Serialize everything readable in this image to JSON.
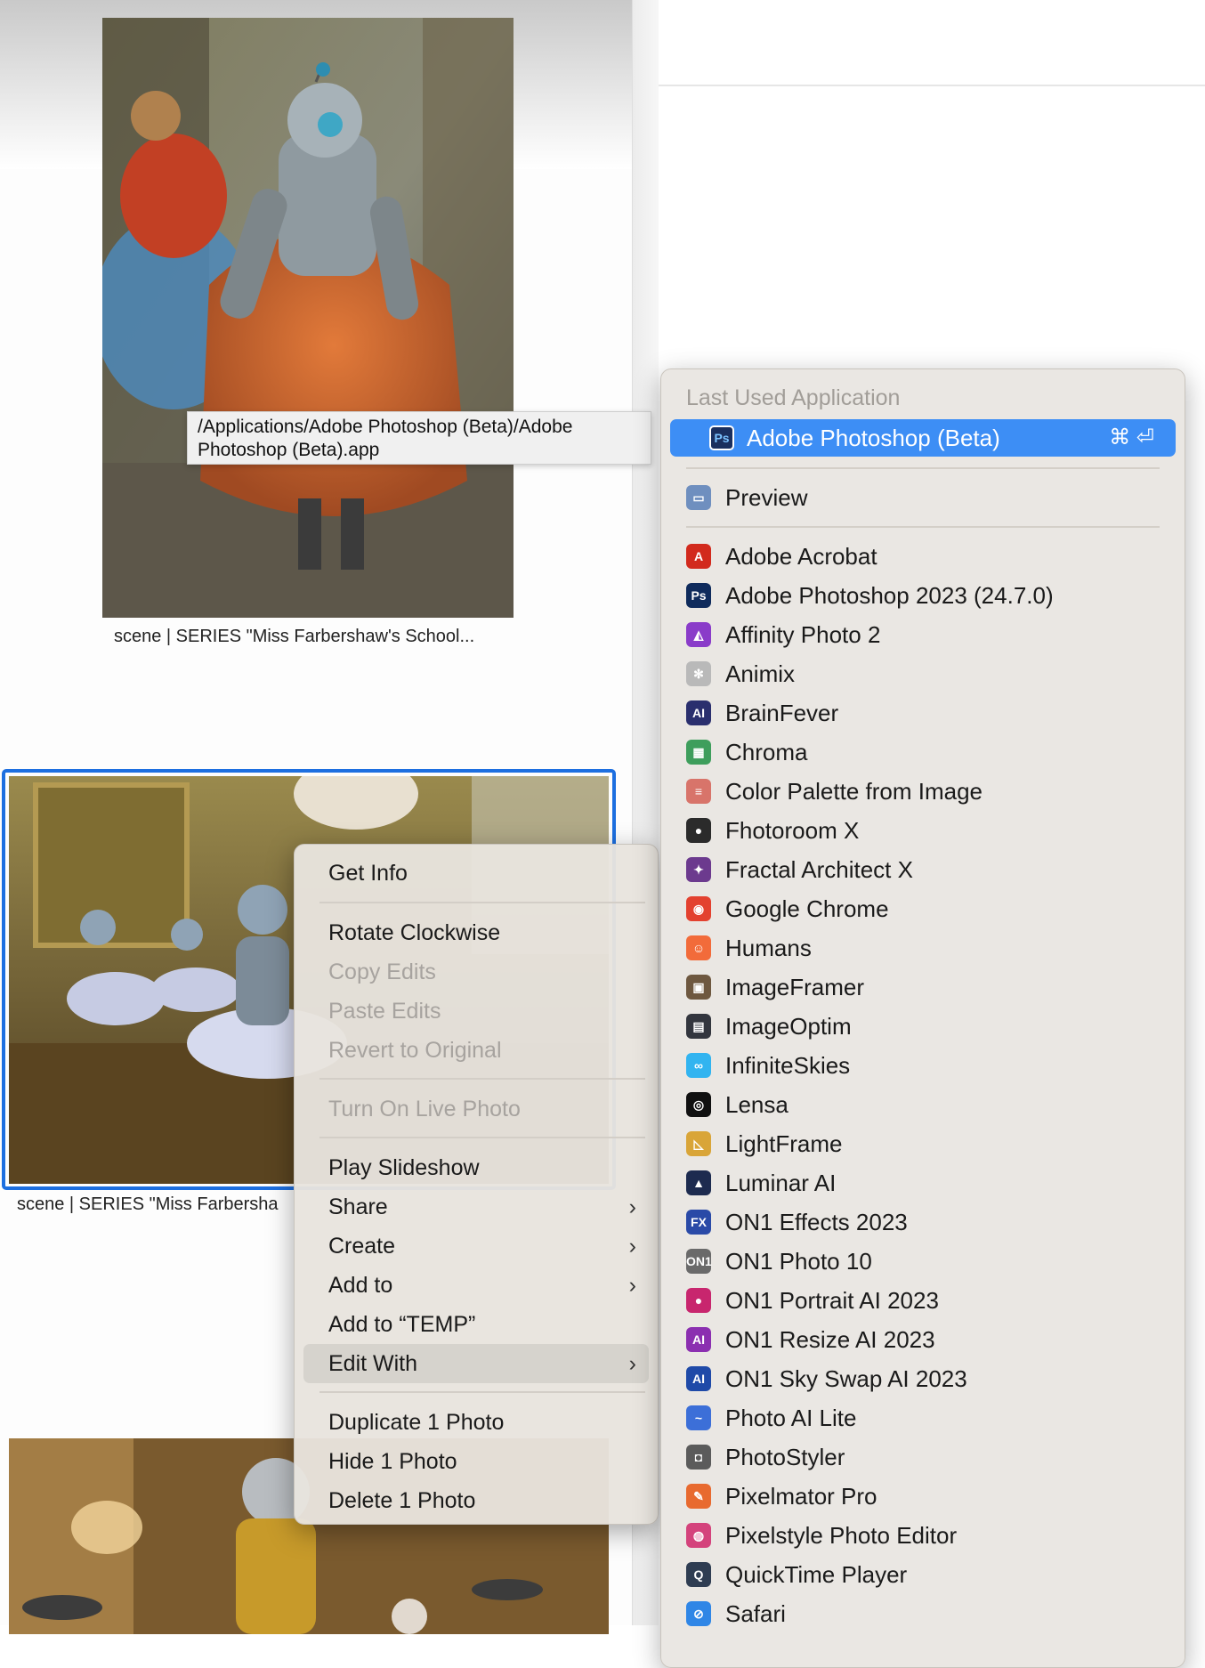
{
  "photos": [
    {
      "caption": "scene | SERIES \"Miss Farbershaw's School..."
    },
    {
      "caption": "scene | SERIES \"Miss Farbersha"
    }
  ],
  "tooltip": {
    "line1": "/Applications/Adobe Photoshop (Beta)/Adobe",
    "line2": "Photoshop (Beta).app"
  },
  "context_menu": {
    "get_info": "Get Info",
    "rotate_clockwise": "Rotate Clockwise",
    "copy_edits": "Copy Edits",
    "paste_edits": "Paste Edits",
    "revert_to_original": "Revert to Original",
    "turn_on_live_photo": "Turn On Live Photo",
    "play_slideshow": "Play Slideshow",
    "share": "Share",
    "create": "Create",
    "add_to": "Add to",
    "add_to_temp": "Add to “TEMP”",
    "edit_with": "Edit With",
    "duplicate": "Duplicate 1 Photo",
    "hide": "Hide 1 Photo",
    "delete": "Delete 1 Photo",
    "chevron": "›"
  },
  "submenu": {
    "header": "Last Used Application",
    "last_used": {
      "label": "Adobe Photoshop (Beta)",
      "icon_text": "Ps",
      "shortcut": "⌘ ⏎"
    },
    "preview": {
      "label": "Preview",
      "icon_color": "#6f8fbf"
    },
    "apps": [
      {
        "label": "Adobe Acrobat",
        "icon_color": "#d22a1d",
        "icon_text": "A"
      },
      {
        "label": "Adobe Photoshop 2023 (24.7.0)",
        "icon_color": "#0f2b5c",
        "icon_text": "Ps"
      },
      {
        "label": "Affinity Photo 2",
        "icon_color": "#8a3cc9",
        "icon_text": "◭"
      },
      {
        "label": "Animix",
        "icon_color": "#b9b9b9",
        "icon_text": "✻"
      },
      {
        "label": "BrainFever",
        "icon_color": "#2a2f6e",
        "icon_text": "AI"
      },
      {
        "label": "Chroma",
        "icon_color": "#3e9e5c",
        "icon_text": "▦"
      },
      {
        "label": "Color Palette from Image",
        "icon_color": "#d8746a",
        "icon_text": "≡"
      },
      {
        "label": "Fhotoroom X",
        "icon_color": "#2b2b2b",
        "icon_text": "●"
      },
      {
        "label": "Fractal Architect X",
        "icon_color": "#6c3a8e",
        "icon_text": "✦"
      },
      {
        "label": "Google Chrome",
        "icon_color": "#e3412f",
        "icon_text": "◉"
      },
      {
        "label": "Humans",
        "icon_color": "#f26b3a",
        "icon_text": "☺"
      },
      {
        "label": "ImageFramer",
        "icon_color": "#6e5840",
        "icon_text": "▣"
      },
      {
        "label": "ImageOptim",
        "icon_color": "#33363e",
        "icon_text": "▤"
      },
      {
        "label": "InfiniteSkies",
        "icon_color": "#32b4f0",
        "icon_text": "∞"
      },
      {
        "label": "Lensa",
        "icon_color": "#111111",
        "icon_text": "◎"
      },
      {
        "label": "LightFrame",
        "icon_color": "#d9a538",
        "icon_text": "◺"
      },
      {
        "label": "Luminar AI",
        "icon_color": "#1d2b4f",
        "icon_text": "▲"
      },
      {
        "label": "ON1 Effects 2023",
        "icon_color": "#2a4aa7",
        "icon_text": "FX"
      },
      {
        "label": "ON1 Photo 10",
        "icon_color": "#6a6a6a",
        "icon_text": "ON1"
      },
      {
        "label": "ON1 Portrait AI 2023",
        "icon_color": "#c8266e",
        "icon_text": "●"
      },
      {
        "label": "ON1 Resize AI 2023",
        "icon_color": "#8b2fb0",
        "icon_text": "AI"
      },
      {
        "label": "ON1 Sky Swap AI 2023",
        "icon_color": "#1f4aa8",
        "icon_text": "AI"
      },
      {
        "label": "Photo AI Lite",
        "icon_color": "#3c6fd8",
        "icon_text": "~"
      },
      {
        "label": "PhotoStyler",
        "icon_color": "#5b5b5b",
        "icon_text": "◘"
      },
      {
        "label": "Pixelmator Pro",
        "icon_color": "#e86a2f",
        "icon_text": "✎"
      },
      {
        "label": "Pixelstyle Photo Editor",
        "icon_color": "#d4437c",
        "icon_text": "◍"
      },
      {
        "label": "QuickTime Player",
        "icon_color": "#2f3d52",
        "icon_text": "Q"
      },
      {
        "label": "Safari",
        "icon_color": "#2f86e6",
        "icon_text": "⊘"
      }
    ]
  }
}
